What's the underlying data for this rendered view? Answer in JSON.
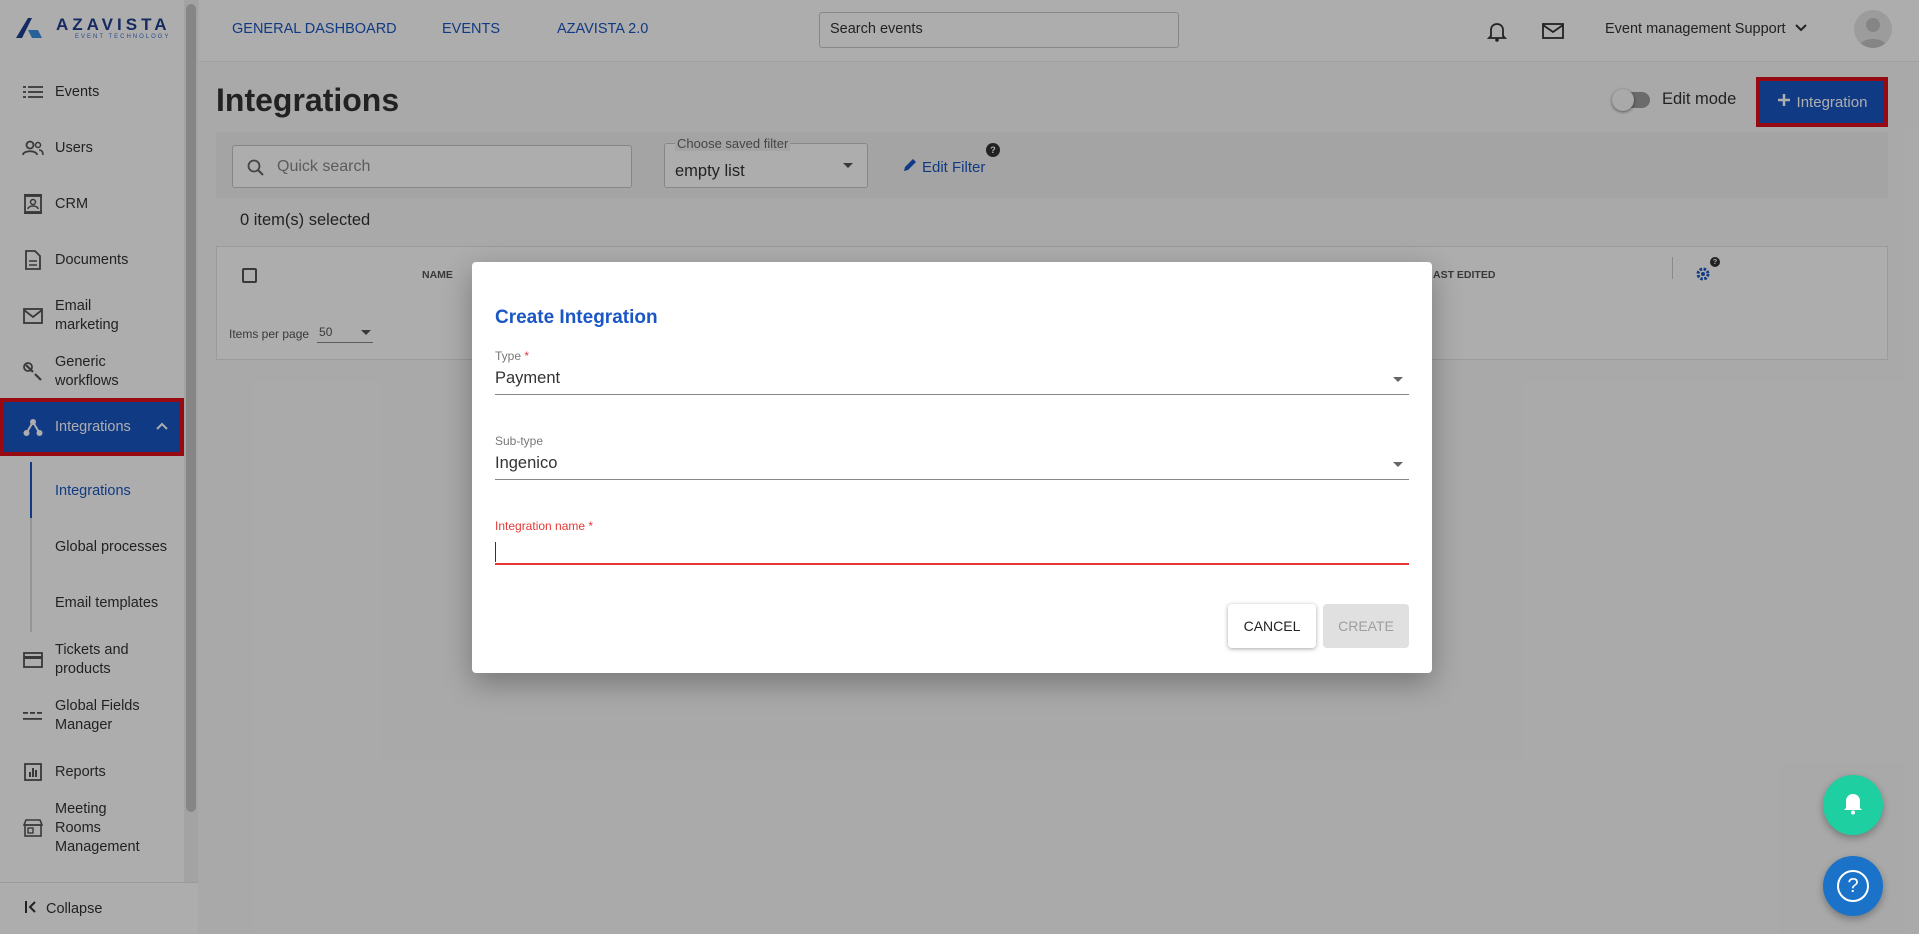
{
  "brand": {
    "name": "AZAVISTA",
    "tagline": "EVENT TECHNOLOGY"
  },
  "sidebar": {
    "items": [
      {
        "label": "Events",
        "icon": "list-icon"
      },
      {
        "label": "Users",
        "icon": "users-icon"
      },
      {
        "label": "CRM",
        "icon": "contacts-icon"
      },
      {
        "label": "Documents",
        "icon": "document-icon"
      },
      {
        "label": "Email\nmarketing",
        "icon": "mail-icon"
      },
      {
        "label": "Generic\nworkflows",
        "icon": "wrench-icon"
      },
      {
        "label": "Integrations",
        "icon": "integration-icon"
      },
      {
        "label": "Tickets and\nproducts",
        "icon": "card-icon"
      },
      {
        "label": "Global Fields\nManager",
        "icon": "fields-icon"
      },
      {
        "label": "Reports",
        "icon": "chart-icon"
      },
      {
        "label": "Meeting\nRooms\nManagement",
        "icon": "store-icon"
      }
    ],
    "subitems": [
      "Integrations",
      "Global processes",
      "Email templates"
    ],
    "collapse_label": "Collapse"
  },
  "topbar": {
    "links": [
      "GENERAL DASHBOARD",
      "EVENTS",
      "AZAVISTA 2.0"
    ],
    "search_placeholder": "Search events",
    "user_name": "Event management Support"
  },
  "page": {
    "title": "Integrations",
    "edit_mode_label": "Edit mode",
    "add_button_label": "Integration",
    "quick_search_placeholder": "Quick search",
    "saved_filter_label": "Choose saved filter",
    "saved_filter_value": "empty list",
    "edit_filter_label": "Edit Filter",
    "selected_count": "0 item(s) selected",
    "table_headers": [
      "NAME",
      "AST EDITED"
    ],
    "items_per_page_label": "Items per page",
    "items_per_page_value": "50"
  },
  "dialog": {
    "title": "Create Integration",
    "type_label": "Type",
    "type_value": "Payment",
    "subtype_label": "Sub-type",
    "subtype_value": "Ingenico",
    "name_label": "Integration name",
    "name_value": "",
    "cancel_label": "CANCEL",
    "create_label": "CREATE"
  },
  "colors": {
    "accent": "#1a56c4",
    "highlight": "#e0101a",
    "error": "#e53935",
    "fab_bell": "#1ecfa1",
    "fab_help": "#1a73c8"
  }
}
